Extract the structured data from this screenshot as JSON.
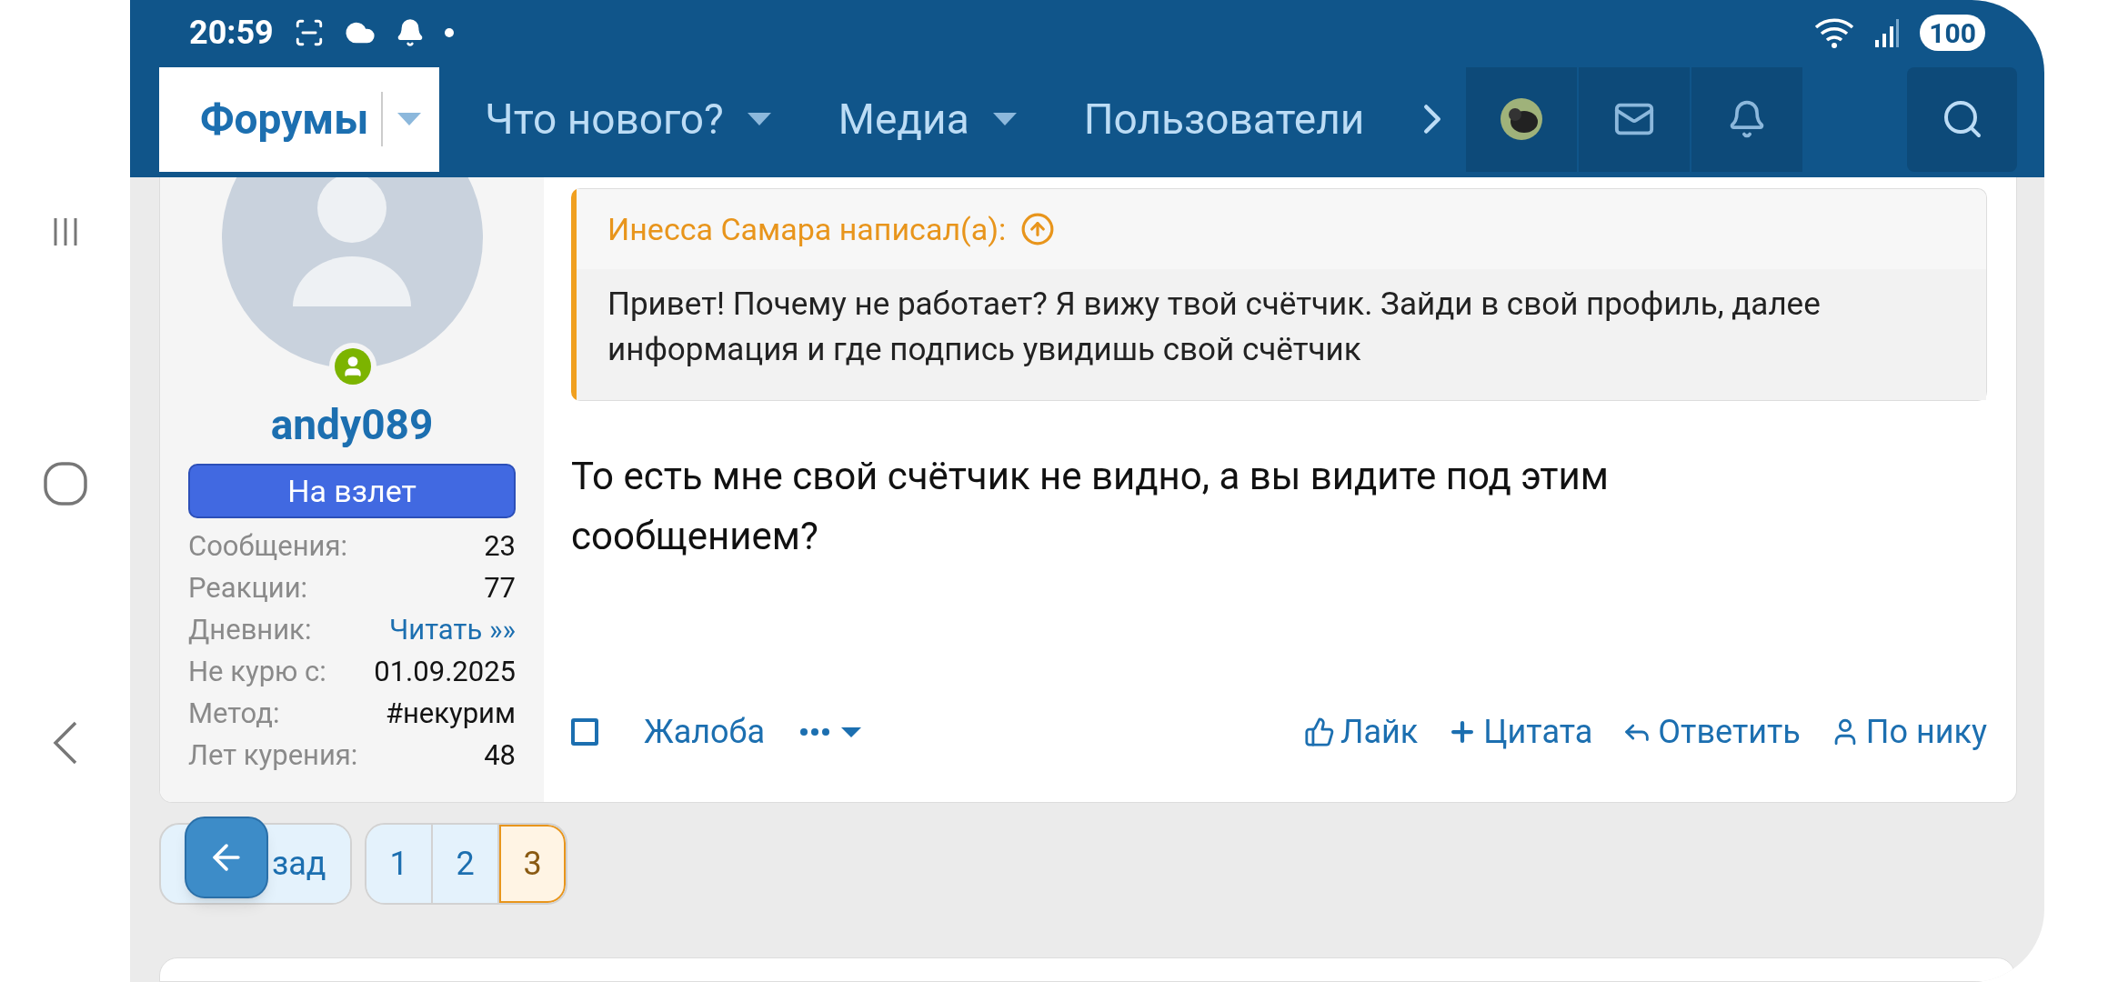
{
  "status_bar": {
    "time": "20:59",
    "battery": "100"
  },
  "nav": {
    "tabs": [
      {
        "label": "Форумы",
        "selected": true
      },
      {
        "label": "Что нового?",
        "selected": false
      },
      {
        "label": "Медиа",
        "selected": false
      },
      {
        "label": "Пользователи",
        "selected": false
      }
    ]
  },
  "post": {
    "author": {
      "name": "andy089",
      "online": true,
      "rank": "На взлет",
      "stats": [
        {
          "label": "Сообщения:",
          "value": "23",
          "kind": "text"
        },
        {
          "label": "Реакции:",
          "value": "77",
          "kind": "text"
        },
        {
          "label": "Дневник:",
          "value": "Читать »»",
          "kind": "link"
        },
        {
          "label": "Не курю с:",
          "value": "01.09.2025",
          "kind": "text"
        },
        {
          "label": "Метод:",
          "value": "#некурим",
          "kind": "text"
        },
        {
          "label": "Лет курения:",
          "value": "48",
          "kind": "text"
        }
      ]
    },
    "quote": {
      "author": "Инесса Самара написал(а):",
      "text": "Привет! Почему не работает? Я вижу твой счётчик. Зайди в свой профиль, далее информация и где подпись увидишь свой счётчик"
    },
    "message": "То есть мне свой счётчик не видно, а вы видите под этим сообщением?",
    "select_checked": false,
    "report": "Жалоба",
    "actions": [
      {
        "label": "Лайк",
        "kind": "like"
      },
      {
        "label": "Цитата",
        "kind": "quote"
      },
      {
        "label": "Ответить",
        "kind": "reply"
      },
      {
        "label": "По нику",
        "kind": "user"
      }
    ]
  },
  "pagination": {
    "prev": "зад",
    "pages": [
      {
        "label": "1",
        "selected": false
      },
      {
        "label": "2",
        "selected": false
      },
      {
        "label": "3",
        "selected": true
      }
    ]
  }
}
